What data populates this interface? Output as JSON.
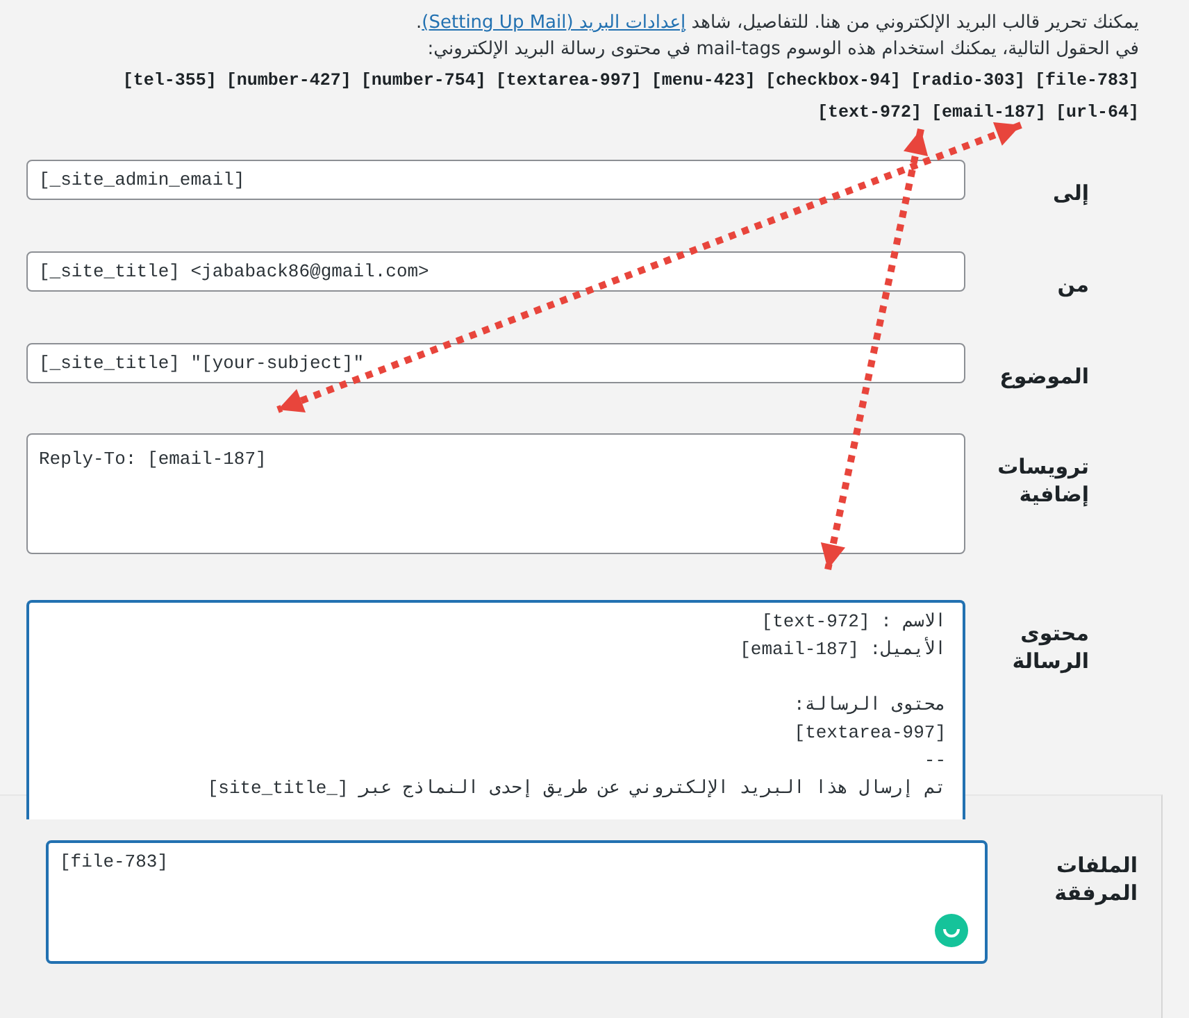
{
  "intro": {
    "text_before": "يمكنك تحرير قالب البريد الإلكتروني من هنا. للتفاصيل، شاهد ",
    "link": "إعدادات البريد (Setting Up Mail)",
    "text_after": ".",
    "tags_hint": "في الحقول التالية، يمكنك استخدام هذه الوسوم mail-tags في محتوى رسالة البريد الإلكتروني:"
  },
  "tags": [
    "[file-783]",
    "[radio-303]",
    "[checkbox-94]",
    "[menu-423]",
    "[textarea-997]",
    "[number-754]",
    "[number-427]",
    "[tel-355]",
    "[url-64]",
    "[email-187]",
    "[text-972]"
  ],
  "fields": [
    {
      "label": "إلى",
      "kind": "input",
      "value": "[_site_admin_email]",
      "focused": false
    },
    {
      "label": "من",
      "kind": "input",
      "value": "[_site_title] <jababack86@gmail.com>",
      "focused": false
    },
    {
      "label": "الموضوع",
      "kind": "input",
      "value": "[_site_title] \"[your-subject]\"",
      "focused": false
    },
    {
      "label": "ترويسات إضافية",
      "kind": "textarea",
      "value": "Reply-To: [email-187]",
      "focused": false
    },
    {
      "label": "محتوى الرسالة",
      "kind": "body",
      "value": "الاسم : [text-972]\nالأيميل: [email-187]\n\nمحتوى الرسالة:\n[textarea-997]\n--\nتم إرسال هذا البريد الإلكتروني عن طريق إحدى النماذج عبر [_site_title]",
      "focused": true
    }
  ],
  "attachments": {
    "label": "الملفات المرفقة",
    "value": "[file-783]",
    "focused": true
  }
}
